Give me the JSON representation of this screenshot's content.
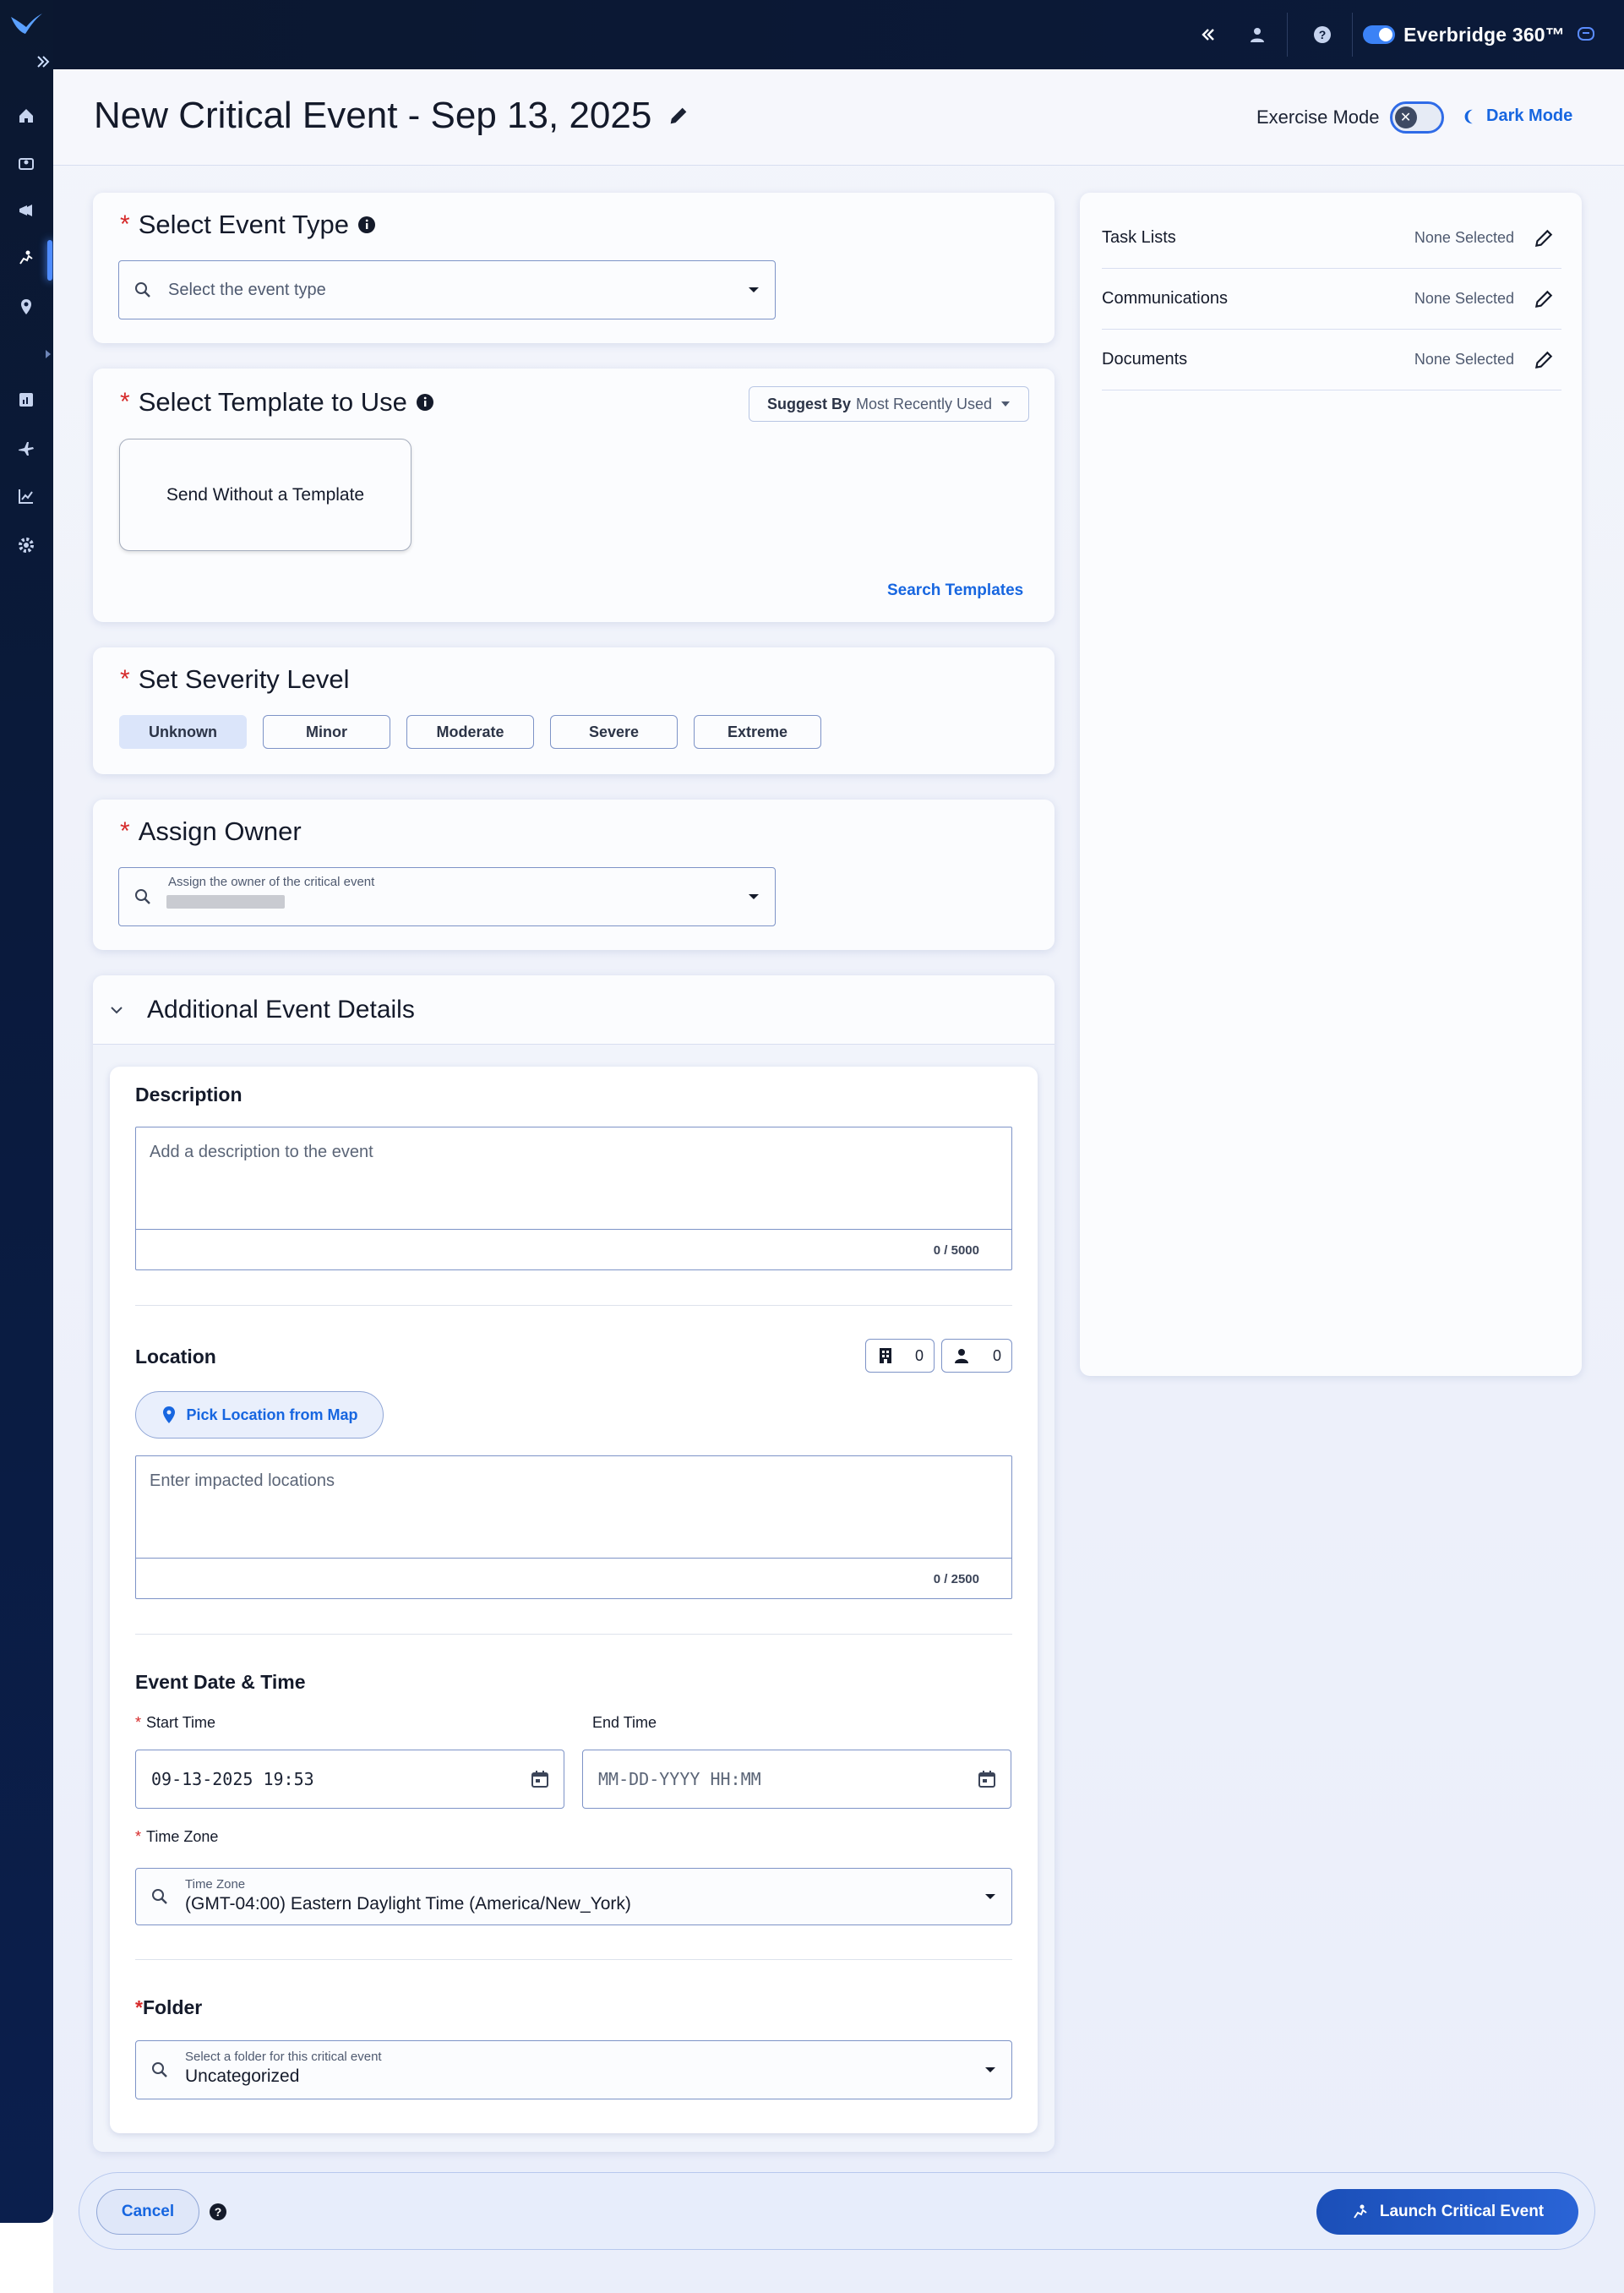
{
  "topbar": {
    "brand": "Everbridge 360™"
  },
  "header": {
    "title": "New Critical Event - Sep 13, 2025",
    "exercise_mode_label": "Exercise Mode",
    "dark_mode_label": "Dark Mode"
  },
  "event_type": {
    "title": "Select Event Type",
    "placeholder": "Select the event type"
  },
  "template": {
    "title": "Select Template to Use",
    "suggest_by_label": "Suggest By",
    "suggest_by_value": "Most Recently Used",
    "tile_label": "Send Without a Template",
    "search_link": "Search Templates"
  },
  "severity": {
    "title": "Set Severity Level",
    "levels": [
      "Unknown",
      "Minor",
      "Moderate",
      "Severe",
      "Extreme"
    ],
    "selected": "Unknown"
  },
  "owner": {
    "title": "Assign Owner",
    "field_label": "Assign the owner of the critical event"
  },
  "additional": {
    "title": "Additional Event Details",
    "description": {
      "label": "Description",
      "placeholder": "Add a description to the event",
      "count": "0 / 5000"
    },
    "location": {
      "label": "Location",
      "buildings_count": "0",
      "people_count": "0",
      "pick_button": "Pick Location from Map",
      "placeholder": "Enter impacted locations",
      "count": "0 / 2500"
    },
    "datetime": {
      "label": "Event Date & Time",
      "start_label": "Start Time",
      "start_value": "09-13-2025 19:53",
      "end_label": "End Time",
      "end_placeholder": "MM-DD-YYYY HH:MM",
      "tz_label": "Time Zone",
      "tz_float_label": "Time Zone",
      "tz_value": "(GMT-04:00) Eastern Daylight Time (America/New_York)"
    },
    "folder": {
      "label": "Folder",
      "float_label": "Select a folder for this critical event",
      "value": "Uncategorized"
    }
  },
  "sidebar_right": {
    "rows": [
      {
        "label": "Task Lists",
        "value": "None Selected"
      },
      {
        "label": "Communications",
        "value": "None Selected"
      },
      {
        "label": "Documents",
        "value": "None Selected"
      }
    ]
  },
  "footer": {
    "cancel": "Cancel",
    "launch": "Launch Critical Event"
  },
  "colors": {
    "accent": "#1766e0",
    "required": "#d62a2a",
    "rail": "#0b1830"
  }
}
